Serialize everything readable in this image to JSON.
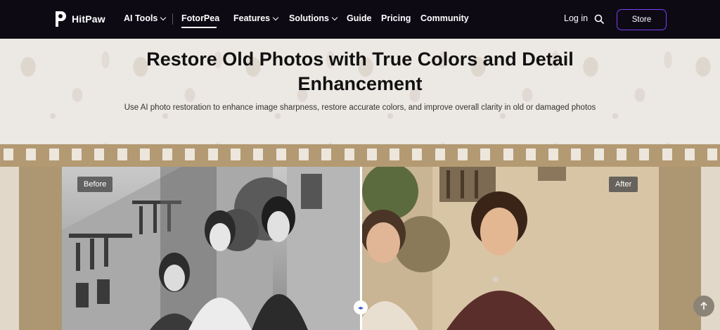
{
  "nav": {
    "brand": "HitPaw",
    "items": [
      {
        "label": "AI Tools",
        "dropdown": true
      },
      {
        "label": "FotorPea",
        "dropdown": false,
        "active": true
      },
      {
        "label": "Features",
        "dropdown": true
      },
      {
        "label": "Solutions",
        "dropdown": true
      },
      {
        "label": "Guide",
        "dropdown": false
      },
      {
        "label": "Pricing",
        "dropdown": false
      },
      {
        "label": "Community",
        "dropdown": false
      }
    ],
    "login": "Log in",
    "store": "Store",
    "accent_color": "#7a3ff2"
  },
  "hero": {
    "title": "Restore Old Photos with True Colors and Detail Enhancement",
    "subtitle": "Use AI photo restoration to enhance image sharpness, restore accurate colors, and improve overall clarity in old or damaged photos"
  },
  "comparison": {
    "before_label": "Before",
    "after_label": "After",
    "handle_glyph": "◂▸",
    "slider_position_percent": 50
  },
  "icons": {
    "search": "search-icon",
    "scroll_top": "arrow-up-icon",
    "logo": "hitpaw-logo-icon"
  }
}
